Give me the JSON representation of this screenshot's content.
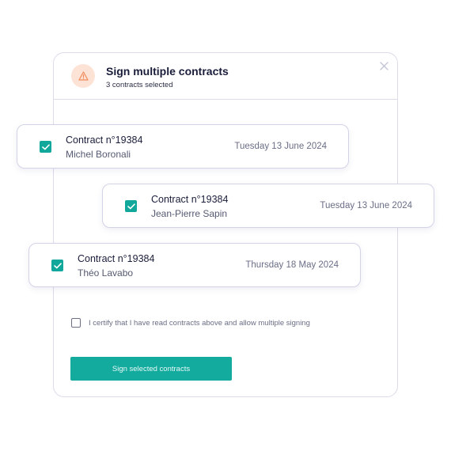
{
  "dialog": {
    "title": "Sign multiple contracts",
    "subtitle": "3 contracts selected",
    "icon": "warning-triangle-icon",
    "accent_color": "#f28b5a"
  },
  "contracts": [
    {
      "name": "Contract n°19384",
      "person": "Michel Boronali",
      "date": "Tuesday 13 June 2024",
      "checked": true
    },
    {
      "name": "Contract n°19384",
      "person": "Jean-Pierre Sapin",
      "date": "Tuesday 13 June 2024",
      "checked": true
    },
    {
      "name": "Contract n°19384",
      "person": "Théo Lavabo",
      "date": "Thursday 18 May 2024",
      "checked": true
    }
  ],
  "certify": {
    "label": "I certify that I have read contracts above and allow multiple signing",
    "checked": false
  },
  "actions": {
    "sign_label": "Sign selected contracts",
    "primary_color": "#12ab9e"
  }
}
